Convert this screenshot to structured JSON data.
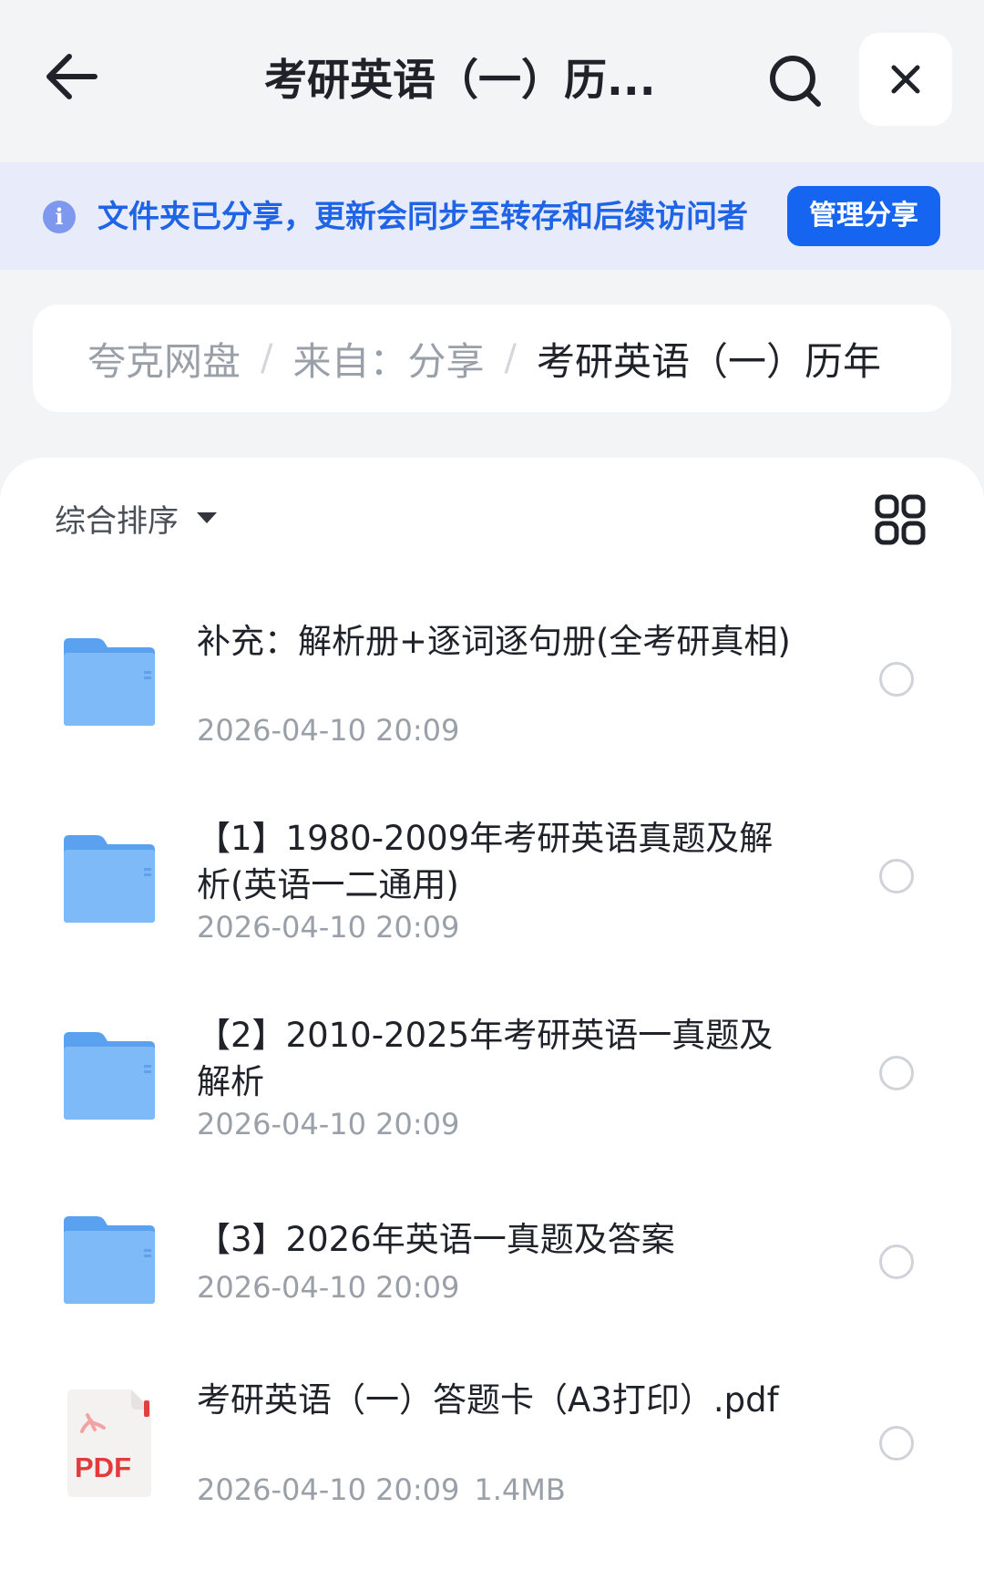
{
  "header": {
    "title": "考研英语（一）历...",
    "icons": {
      "back": "arrow-left-icon",
      "search": "search-icon",
      "close": "close-icon"
    }
  },
  "banner": {
    "info_glyph": "i",
    "text": "文件夹已分享，更新会同步至转存和后续访问者",
    "manage_label": "管理分享",
    "colors": {
      "background": "#e8ecfa",
      "text": "#1f64e6",
      "button": "#1565f0"
    }
  },
  "breadcrumb": {
    "items": [
      "夸克网盘",
      "来自：分享",
      "考研英语（一）历年"
    ],
    "separator": "/"
  },
  "toolbar": {
    "sort_label": "综合排序",
    "view_toggle_icon": "grid-view-icon"
  },
  "files": [
    {
      "type": "folder",
      "icon": "folder-icon",
      "name": "补充：解析册+逐词逐句册(全考研真相)",
      "date": "2026-04-10 20:09",
      "size": ""
    },
    {
      "type": "folder",
      "icon": "folder-icon",
      "name": "【1】1980-2009年考研英语真题及解析(英语一二通用)",
      "date": "2026-04-10 20:09",
      "size": ""
    },
    {
      "type": "folder",
      "icon": "folder-icon",
      "name": "【2】2010-2025年考研英语一真题及解析",
      "date": "2026-04-10 20:09",
      "size": ""
    },
    {
      "type": "folder",
      "icon": "folder-icon",
      "name": "【3】2026年英语一真题及答案",
      "date": "2026-04-10 20:09",
      "size": ""
    },
    {
      "type": "pdf",
      "icon": "pdf-file-icon",
      "badge": "PDF",
      "name": "考研英语（一）答题卡（A3打印）.pdf",
      "date": "2026-04-10 20:09",
      "size": "1.4MB"
    }
  ]
}
